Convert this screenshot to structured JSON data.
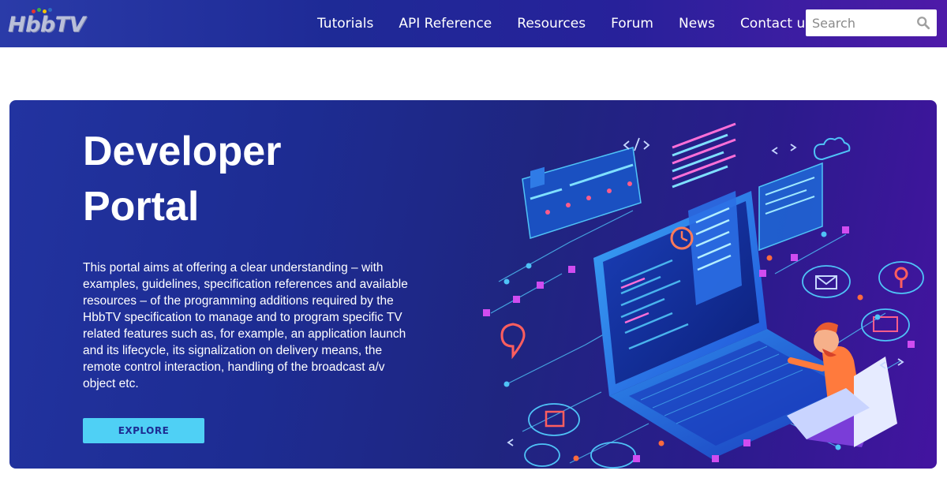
{
  "header": {
    "logo_text": "HbbTV",
    "logo_dot_colors": [
      "#e8342e",
      "#3fae49",
      "#f2c200",
      "#2b6cc4"
    ],
    "nav": [
      {
        "label": "Tutorials"
      },
      {
        "label": "API Reference"
      },
      {
        "label": "Resources"
      },
      {
        "label": "Forum"
      },
      {
        "label": "News"
      },
      {
        "label": "Contact us"
      }
    ],
    "search": {
      "placeholder": "Search",
      "icon": "search-icon"
    }
  },
  "hero": {
    "title": "Developer Portal",
    "description": "This portal aims at offering a clear understanding – with examples, guidelines, specification references and available resources – of the programming additions required by the HbbTV specification to manage and to program specific TV related features such as, for example, an application launch and its lifecycle, its signalization on delivery means, the remote control interaction, handling of the broadcast a/v object etc.",
    "button_label": "EXPLORE",
    "illustration_icon": "isometric-laptop-developer-illustration"
  },
  "colors": {
    "nav_gradient_start": "#2a3ba8",
    "nav_gradient_end": "#4e1aa8",
    "accent": "#4fd0f5",
    "hero_bg": "#1d2c92"
  }
}
